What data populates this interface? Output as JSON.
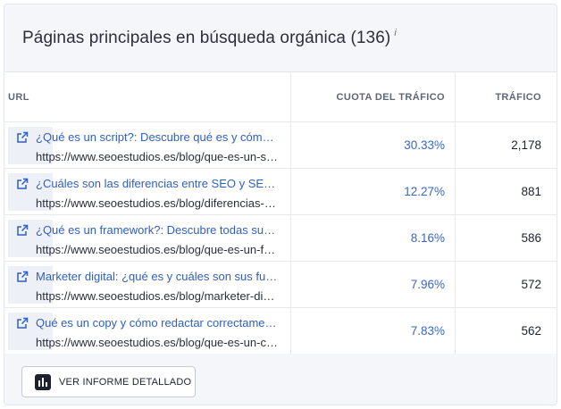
{
  "widget": {
    "title": "Páginas principales en búsqueda orgánica (136)",
    "info_mark": "i"
  },
  "table": {
    "columns": [
      "URL",
      "CUOTA DEL TRÁFICO",
      "TRÁFICO"
    ],
    "rows": [
      {
        "title": "¿Qué es un script?: Descubre qué es y cómo funciona",
        "url": "https://www.seoestudios.es/blog/que-es-un-script",
        "share": "30.33%",
        "traffic": "2,178"
      },
      {
        "title": "¿Cuáles son las diferencias entre SEO y SEM?",
        "url": "https://www.seoestudios.es/blog/diferencias-seo-sem",
        "share": "12.27%",
        "traffic": "881"
      },
      {
        "title": "¿Qué es un framework?: Descubre todas sus ventajas",
        "url": "https://www.seoestudios.es/blog/que-es-un-framework",
        "share": "8.16%",
        "traffic": "586"
      },
      {
        "title": "Marketer digital: ¿qué es y cuáles son sus funciones?",
        "url": "https://www.seoestudios.es/blog/marketer-digital",
        "share": "7.96%",
        "traffic": "572"
      },
      {
        "title": "Qué es un copy y cómo redactar correctamente",
        "url": "https://www.seoestudios.es/blog/que-es-un-copy",
        "share": "7.83%",
        "traffic": "562"
      }
    ]
  },
  "footer": {
    "button_label": "VER INFORME DETALLADO",
    "button_icon": "bar-chart-icon"
  },
  "colors": {
    "link": "#2f5fbf",
    "share_value": "#3a67c6",
    "header_bg": "#f5f6f9",
    "border": "#e3e6ee"
  }
}
